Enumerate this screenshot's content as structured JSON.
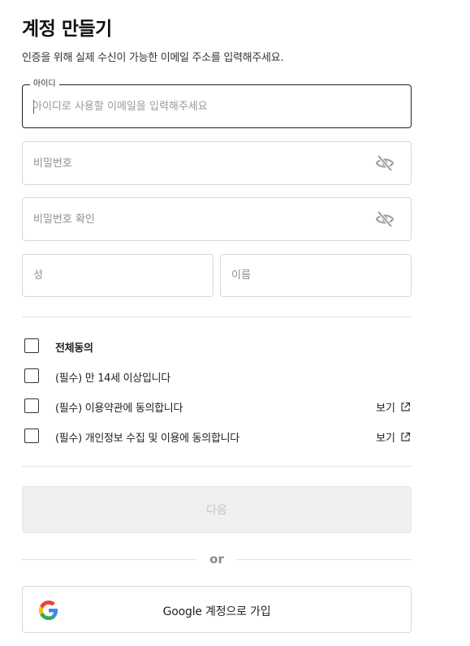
{
  "header": {
    "title": "계정 만들기",
    "subtitle": "인증을 위해 실제 수신이 가능한 이메일 주소를 입력해주세요."
  },
  "form": {
    "id_field": {
      "label": "아이디",
      "placeholder": "아이디로 사용할 이메일을 입력해주세요",
      "value": ""
    },
    "password_field": {
      "placeholder": "비밀번호",
      "value": "",
      "icon": "eye-off-icon"
    },
    "password_confirm_field": {
      "placeholder": "비밀번호 확인",
      "value": "",
      "icon": "eye-off-icon"
    },
    "last_name_field": {
      "placeholder": "성",
      "value": ""
    },
    "first_name_field": {
      "placeholder": "이름",
      "value": ""
    }
  },
  "agreements": {
    "all": {
      "label": "전체동의",
      "checked": false
    },
    "items": [
      {
        "label": "(필수) 만 14세 이상입니다",
        "checked": false
      },
      {
        "label": "(필수) 이용약관에 동의합니다",
        "checked": false,
        "link": "보기"
      },
      {
        "label": "(필수) 개인정보 수집 및 이용에 동의합니다",
        "checked": false,
        "link": "보기"
      }
    ]
  },
  "actions": {
    "next_label": "다음",
    "next_disabled": true,
    "or_label": "or",
    "google_label": "Google 계정으로 가입"
  },
  "colors": {
    "border": "#d9d9d9",
    "focused_border": "#222222",
    "disabled_bg": "#f0f0f0",
    "disabled_text": "#c4c4c4",
    "google_blue": "#4285F4",
    "google_red": "#EA4335",
    "google_yellow": "#FBBC05",
    "google_green": "#34A853"
  }
}
